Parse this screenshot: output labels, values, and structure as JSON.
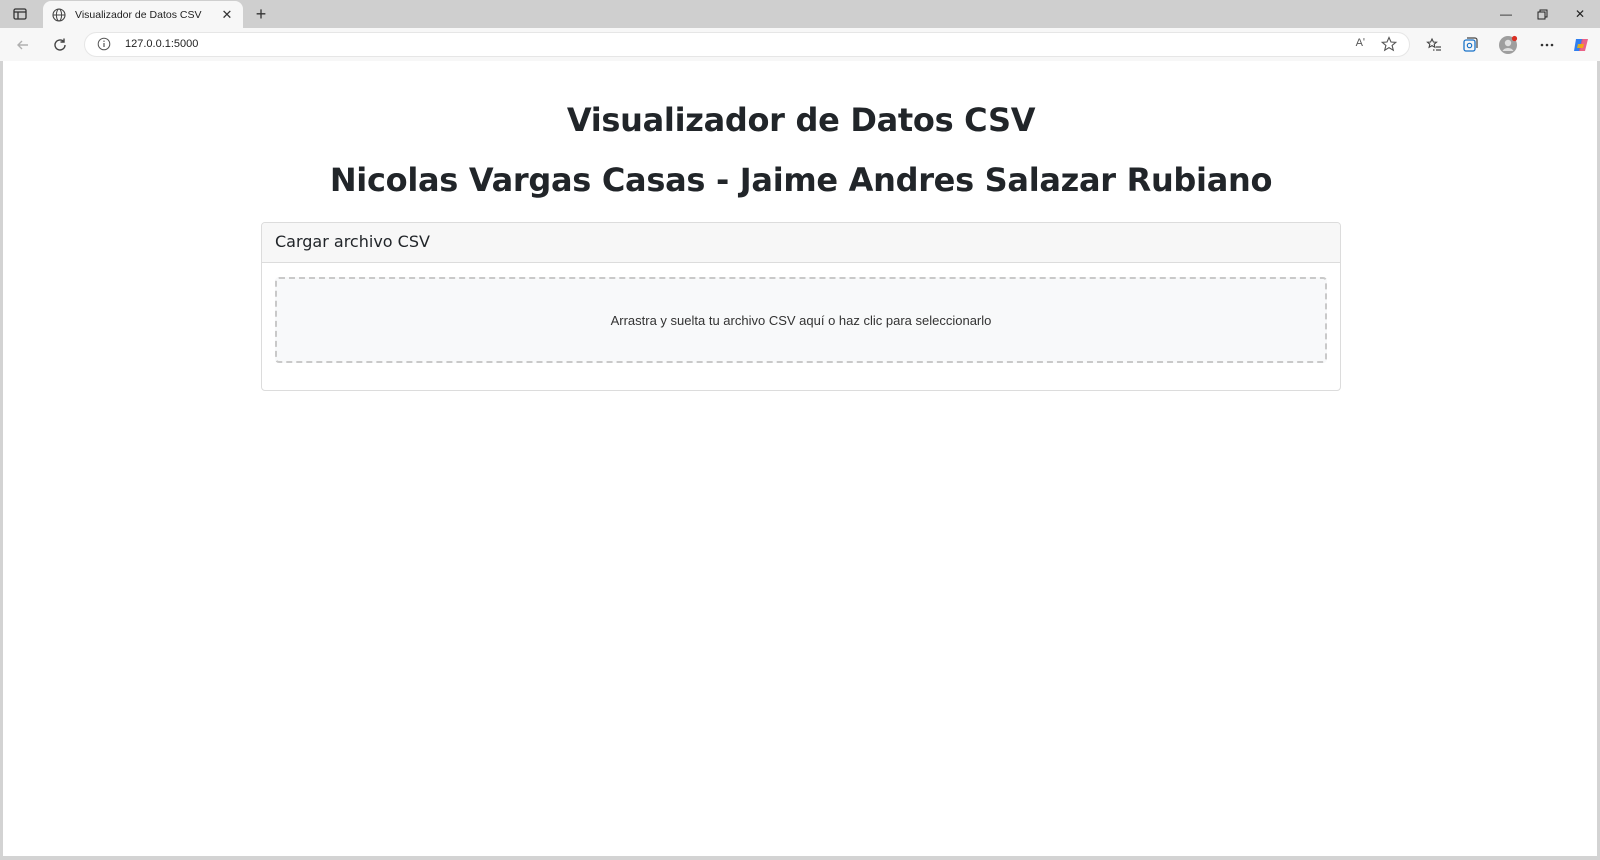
{
  "browser": {
    "tab_title": "Visualizador de Datos CSV",
    "url": "127.0.0.1:5000",
    "read_aloud_label": "Aʹ"
  },
  "page": {
    "title": "Visualizador de Datos CSV",
    "authors": "Nicolas Vargas Casas - Jaime Andres Salazar Rubiano"
  },
  "upload_card": {
    "header": "Cargar archivo CSV",
    "dropzone_text": "Arrastra y suelta tu archivo CSV aquí o haz clic para seleccionarlo"
  },
  "colors": {
    "card_border": "#dcdcdc",
    "dropzone_border": "#c9c9c9",
    "text": "#212529"
  }
}
